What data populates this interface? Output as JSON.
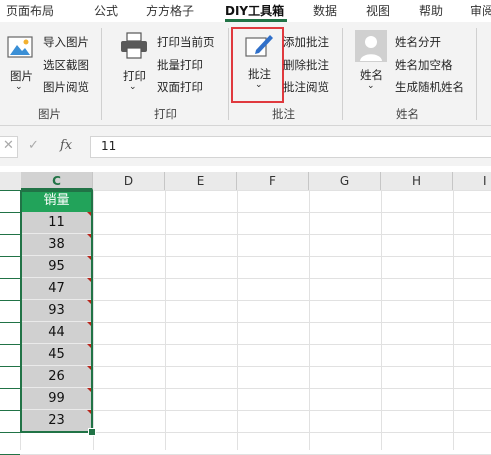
{
  "tabs": [
    "页面布局",
    "公式",
    "方方格子",
    "DIY工具箱",
    "数据",
    "视图",
    "帮助",
    "审阅"
  ],
  "ribbon": {
    "image_group": {
      "big_label": "图片",
      "items": [
        "导入图片",
        "选区截图",
        "图片阅览"
      ],
      "group_label": "图片"
    },
    "print_group": {
      "big_label": "打印",
      "items": [
        "打印当前页",
        "批量打印",
        "双面打印"
      ],
      "group_label": "打印"
    },
    "comment_group": {
      "big_label": "批注",
      "items": [
        "添加批注",
        "删除批注",
        "批注阅览"
      ],
      "group_label": "批注"
    },
    "name_group": {
      "big_label": "姓名",
      "items": [
        "姓名分开",
        "姓名加空格",
        "生成随机姓名"
      ],
      "group_label": "姓名"
    }
  },
  "formula_bar": {
    "cancel": "✕",
    "confirm": "✓",
    "fx": "fx",
    "value": "11"
  },
  "columns": [
    "C",
    "D",
    "E",
    "F",
    "G",
    "H",
    "I"
  ],
  "selected_column": "C",
  "sheet": {
    "header": "销量",
    "values": [
      "11",
      "38",
      "95",
      "47",
      "93",
      "44",
      "45",
      "26",
      "99",
      "23"
    ]
  },
  "colors": {
    "accent": "#217346",
    "header_fill": "#22a35a",
    "highlight_box": "#e0393e",
    "comment_marker": "#b8261c"
  }
}
